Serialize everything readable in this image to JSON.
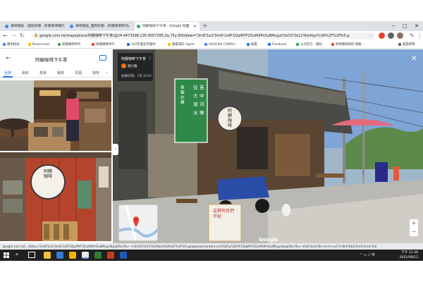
{
  "browser": {
    "tabs": [
      {
        "title": "傳導獨點 - 國防新聞 - 新聞傳導時代",
        "active": false
      },
      {
        "title": "傳導獨點_國際新聞 - 新聞傳導時代",
        "active": false
      },
      {
        "title": "阿靜咖啡下午茶 - Google 地圖",
        "active": true
      }
    ],
    "new_tab": "+",
    "window_controls": [
      "−",
      "□",
      "✕"
    ],
    "url": "google.com.tw/maps/place/阿靜咖啡下午茶/@24.4473396,120.9057285,3a,75y,90t/data=!3m8!1e2!3m6!1sAF1QipMYF2OuMdPnSu8Mujyd!2e10!3e12!6shttps%3A%2F%2Flh5.googleusercontent.com",
    "bookmarks": [
      {
        "label": "應用程式",
        "color": "#4285f4"
      },
      {
        "label": "Bookmarks",
        "color": "#fbbc04"
      },
      {
        "label": "新聞傳導時代",
        "color": "#34a853"
      },
      {
        "label": "新聞傳導時代",
        "color": "#ea4335"
      },
      {
        "label": "102年臺北市國中",
        "color": "#1a73e8"
      },
      {
        "label": "國臺灣的 Agent",
        "color": "#fbbc04"
      },
      {
        "label": "ASUSTeK COMPU...",
        "color": "#4285f4"
      },
      {
        "label": "臉書",
        "color": "#1a73e8"
      },
      {
        "label": "Facebook",
        "color": "#1877f2"
      },
      {
        "label": "公司官方 - 國防...",
        "color": "#34a853"
      },
      {
        "label": "新興傳導政府 網路...",
        "color": "#ea4335"
      },
      {
        "label": "閱讀清單",
        "color": "#5f6368"
      }
    ]
  },
  "left_panel": {
    "title": "阿靜咖啡下午茶",
    "tabs": [
      "全部",
      "最新",
      "菜單",
      "餐飲",
      "氛圍",
      "咖啡"
    ],
    "active_tab": "全部",
    "clock_sign": "阿靜咖啡"
  },
  "street_view": {
    "place": "阿靜咖啡下午茶",
    "author": "趙力雅",
    "date": "拍攝日期：1月 2019",
    "close": "✕",
    "google_logo": "Google",
    "zoom_in": "+",
    "zoom_out": "−",
    "green_sign_lines": [
      "往",
      "大",
      "湖",
      "水",
      "苗",
      "中",
      "河",
      "栗"
    ],
    "green_sign_side": "車輛右轉",
    "clock_sign": "阿靜咖啡",
    "board_text": "這裡有我們不知"
  },
  "status_url": "google.com.tw/.../data=!3m8!1e2!3m6!1sAF1QipMYF2OuMdPnSu8Mujyd4pqORv-Rlu-~ni2e10!3e12!6shttps%3A%2F%2Flh5.googleusercontent.com%2Fp%2FAF1QipMYF2OuMdPnSu8Mujyd4pqORv-Rlu~nfv0!3e12!6s-rst-m-nu173-6k9!6b2!4m5!3m4!1s0",
  "taskbar": {
    "time": "下午 11:38",
    "date": "2021/08/12"
  }
}
